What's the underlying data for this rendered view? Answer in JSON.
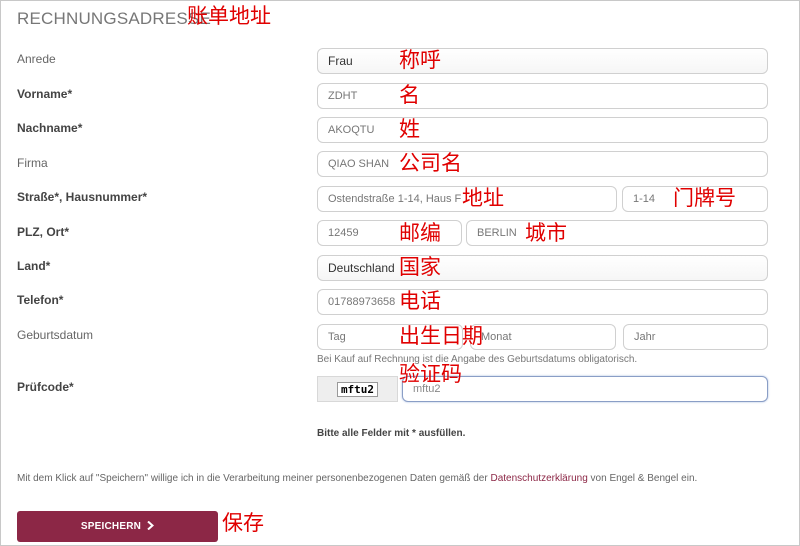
{
  "section": {
    "title": "RECHNUNGSADRESSE",
    "title_annotation": "账单地址"
  },
  "fields": {
    "salutation": {
      "label": "Anrede",
      "value": "Frau",
      "annotation": "称呼"
    },
    "first_name": {
      "label": "Vorname*",
      "value": "ZDHT",
      "annotation": "名"
    },
    "last_name": {
      "label": "Nachname*",
      "value": "AKOQTU",
      "annotation": "姓"
    },
    "company": {
      "label": "Firma",
      "value": "QIAO SHAN",
      "annotation": "公司名"
    },
    "street": {
      "label": "Straße*, Hausnummer*",
      "value": "Ostendstraße 1-14, Haus F",
      "annotation": "地址",
      "number_value": "1-14",
      "number_annotation": "门牌号"
    },
    "zip_city": {
      "label": "PLZ, Ort*",
      "zip_value": "12459",
      "zip_annotation": "邮编",
      "city_value": "BERLIN",
      "city_annotation": "城市"
    },
    "country": {
      "label": "Land*",
      "value": "Deutschland",
      "annotation": "国家"
    },
    "phone": {
      "label": "Telefon*",
      "value": "01788973658",
      "annotation": "电话"
    },
    "birthdate": {
      "label": "Geburtsdatum",
      "day_placeholder": "Tag",
      "month_placeholder": "Monat",
      "year_placeholder": "Jahr",
      "annotation": "出生日期",
      "hint": "Bei Kauf auf Rechnung ist die Angabe des Geburtsdatums obligatorisch."
    },
    "captcha": {
      "label": "Prüfcode*",
      "image_text": "mftu2",
      "value": "mftu2",
      "annotation": "验证码"
    }
  },
  "required_note": "Bitte alle Felder mit * ausfüllen.",
  "consent": {
    "before": "Mit dem Klick auf \"Speichern\" willige ich in die Verarbeitung meiner personenbezogenen Daten gemäß der ",
    "link": "Datenschutzerklärung",
    "after": " von Engel & Bengel ein."
  },
  "save": {
    "label": "SPEICHERN",
    "annotation": "保存",
    "icon": "chevron-right-icon"
  },
  "colors": {
    "accent": "#8c2746",
    "annotation": "#e00000"
  }
}
